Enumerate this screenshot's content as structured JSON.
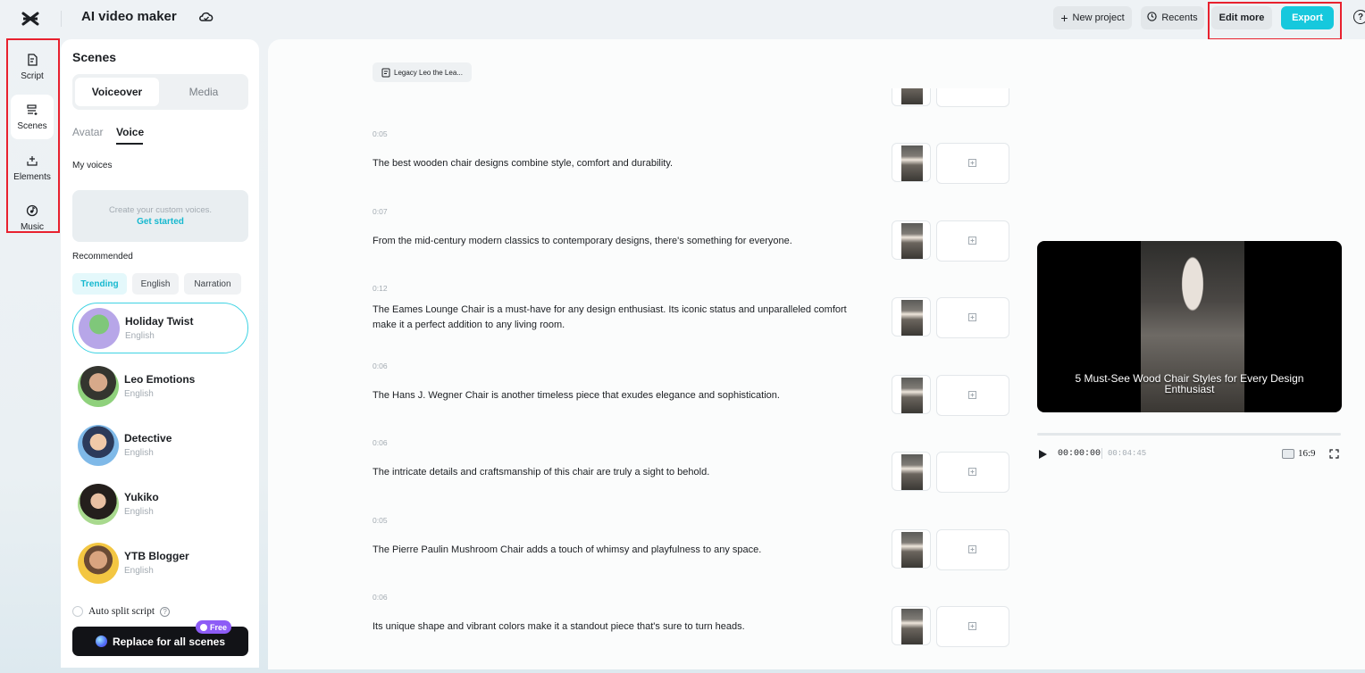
{
  "app": {
    "title": "AI video maker"
  },
  "toolbar": {
    "new_project": "New project",
    "recents": "Recents",
    "edit_more": "Edit more",
    "export": "Export",
    "help": "?",
    "accent_color": "#16c8dd"
  },
  "rail": {
    "items": [
      {
        "label": "Script",
        "icon": "script-icon"
      },
      {
        "label": "Scenes",
        "icon": "scenes-icon",
        "active": true
      },
      {
        "label": "Elements",
        "icon": "elements-icon"
      },
      {
        "label": "Music",
        "icon": "music-icon"
      }
    ]
  },
  "scenes_panel": {
    "title": "Scenes",
    "segments": [
      "Voiceover",
      "Media"
    ],
    "subtabs": [
      "Avatar",
      "Voice"
    ],
    "my_voices_label": "My voices",
    "custom_voice_text": "Create your custom voices.",
    "custom_voice_link": "Get started",
    "recommended_label": "Recommended",
    "chips": [
      "Trending",
      "English",
      "Narration"
    ],
    "voices": [
      {
        "name": "Holiday Twist",
        "lang": "English",
        "selected": true
      },
      {
        "name": "Leo Emotions",
        "lang": "English"
      },
      {
        "name": "Detective",
        "lang": "English"
      },
      {
        "name": "Yukiko",
        "lang": "English"
      },
      {
        "name": "YTB Blogger",
        "lang": "English"
      }
    ],
    "auto_split": "Auto split script",
    "replace_button": "Replace for all scenes",
    "free_badge": "Free"
  },
  "script": {
    "doc_chip": "Legacy Leo the Lea...",
    "scenes": [
      {
        "time": "0:05",
        "text": "The best wooden chair designs combine style, comfort and durability."
      },
      {
        "time": "0:07",
        "text": "From the mid-century modern classics to contemporary designs, there's something for everyone."
      },
      {
        "time": "0:12",
        "text": "The Eames Lounge Chair is a must-have for any design enthusiast. Its iconic status and unparalleled comfort make it a perfect addition to any living room."
      },
      {
        "time": "0:06",
        "text": "The Hans J. Wegner Chair is another timeless piece that exudes elegance and sophistication."
      },
      {
        "time": "0:06",
        "text": "The intricate details and craftsmanship of this chair are truly a sight to behold."
      },
      {
        "time": "0:05",
        "text": "The Pierre Paulin Mushroom Chair adds a touch of whimsy and playfulness to any space."
      },
      {
        "time": "0:06",
        "text": "Its unique shape and vibrant colors make it a standout piece that's sure to turn heads."
      }
    ]
  },
  "preview": {
    "caption": "5 Must-See Wood Chair Styles for Every Design Enthusiast",
    "current_time": "00:00:00",
    "total_time": "00:04:45",
    "ratio": "16:9"
  }
}
